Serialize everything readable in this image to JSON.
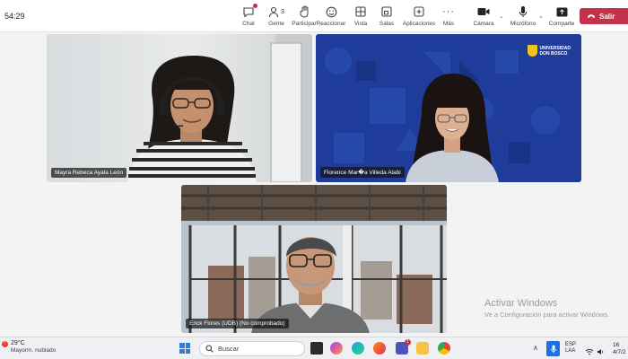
{
  "meeting": {
    "timer": "54:29",
    "toolbar": [
      {
        "name": "chat",
        "label": "Chat"
      },
      {
        "name": "people",
        "label": "Gente",
        "count": "3"
      },
      {
        "name": "raise-hand",
        "label": "Participar"
      },
      {
        "name": "react",
        "label": "Reaccionar"
      },
      {
        "name": "view",
        "label": "Vista"
      },
      {
        "name": "rooms",
        "label": "Salas"
      },
      {
        "name": "apps",
        "label": "Aplicaciones"
      },
      {
        "name": "more",
        "label": "Más"
      },
      {
        "name": "camera",
        "label": "Cámara"
      },
      {
        "name": "mic",
        "label": "Micrófono"
      },
      {
        "name": "share",
        "label": "Comparte"
      }
    ],
    "leave_label": "Salir"
  },
  "participants": [
    {
      "name": "Mayra Rebeca Ayala León"
    },
    {
      "name": "Florence Mar�a Villeda Alabi"
    },
    {
      "name": "Erick Flores (UDB) (No comprobado)"
    }
  ],
  "logo": {
    "line1": "UNIVERSIDAD",
    "line2": "DON BOSCO"
  },
  "watermark": {
    "title": "Activar Windows",
    "subtitle": "Ve a Configuración para activar Windows."
  },
  "taskbar": {
    "weather_temp": "29°C",
    "weather_condition": "Mayorm. nublado",
    "search_placeholder": "Buscar",
    "teams_badge": "1",
    "lang_line1": "ESP",
    "lang_line2": "LAA",
    "time": "16",
    "date": "4/7/2"
  },
  "colors": {
    "accent": "#c4314b",
    "tile_blue": "#1f3c9a",
    "tray_blue": "#1f6fe0"
  }
}
